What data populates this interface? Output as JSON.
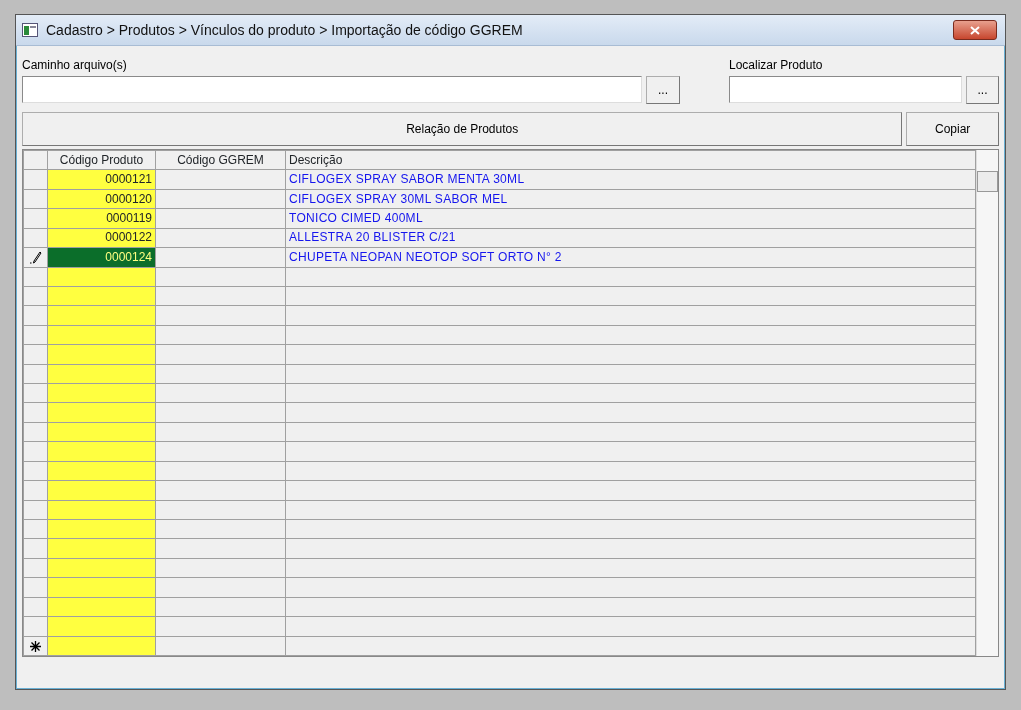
{
  "window": {
    "title": "Cadastro > Produtos > Vínculos do produto > Importação de código GGREM"
  },
  "path_field": {
    "label": "Caminho arquivo(s)",
    "browse": "..."
  },
  "search_field": {
    "label": "Localizar Produto",
    "browse": "..."
  },
  "buttons": [
    "Relação de Produtos",
    "Copiar"
  ],
  "table": {
    "columns": [
      "Código Produto",
      "Código GGREM",
      "Descrição"
    ],
    "rows": [
      {
        "code": "0000121",
        "ggrem": "",
        "description": "CIFLOGEX SPRAY SABOR MENTA 30ML",
        "selected": false
      },
      {
        "code": "0000120",
        "ggrem": "",
        "description": "CIFLOGEX SPRAY 30ML SABOR MEL",
        "selected": false
      },
      {
        "code": "0000119",
        "ggrem": "",
        "description": "TONICO CIMED 400ML",
        "selected": false
      },
      {
        "code": "0000122",
        "ggrem": "",
        "description": "ALLESTRA 20 BLISTER C/21",
        "selected": false
      },
      {
        "code": "0000124",
        "ggrem": "",
        "description": "CHUPETA NEOPAN NEOTOP SOFT ORTO N° 2",
        "selected": true
      }
    ]
  }
}
